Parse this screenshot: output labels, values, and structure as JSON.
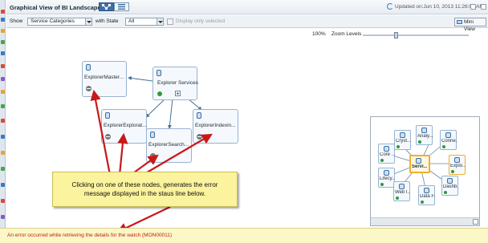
{
  "header": {
    "title": "Graphical View of BI Landscape",
    "updated": "Updated on:Jun 10, 2013 11:26:08 AM"
  },
  "filter": {
    "show_label": "Show",
    "category_value": "Service Categories",
    "state_label": "with State",
    "state_value": "All",
    "checkbox_label": "Display only selected",
    "mini_view_label": "Mini View"
  },
  "zoom": {
    "percent": "100%",
    "label": "Zoom Levels"
  },
  "nodes": [
    {
      "id": "master",
      "label": "ExplorerMaster..."
    },
    {
      "id": "services",
      "label": "Explorer Services"
    },
    {
      "id": "explorat",
      "label": "ExplorerExplorat..."
    },
    {
      "id": "search",
      "label": "ExplorerSearch..."
    },
    {
      "id": "indexin",
      "label": "ExplorerIndexin..."
    }
  ],
  "mini_view": {
    "nodes": [
      {
        "label": "Analy..."
      },
      {
        "label": "Cryst..."
      },
      {
        "label": "Conne..."
      },
      {
        "label": "Core ..."
      },
      {
        "label": "Servi..."
      },
      {
        "label": "Explo..."
      },
      {
        "label": "Lifecy..."
      },
      {
        "label": "Dashb..."
      },
      {
        "label": "Web I..."
      },
      {
        "label": "Data F..."
      }
    ]
  },
  "callout": "Clicking on one of these nodes, generates the error message displayed in the staus line below.",
  "status": "An error occurred while retrieving the details for the watch (MON00011)",
  "colors": {
    "accent": "#3f6fa3",
    "error_text": "#c0201a",
    "callout_bg": "#fbf39d",
    "arrow": "#c81818"
  }
}
